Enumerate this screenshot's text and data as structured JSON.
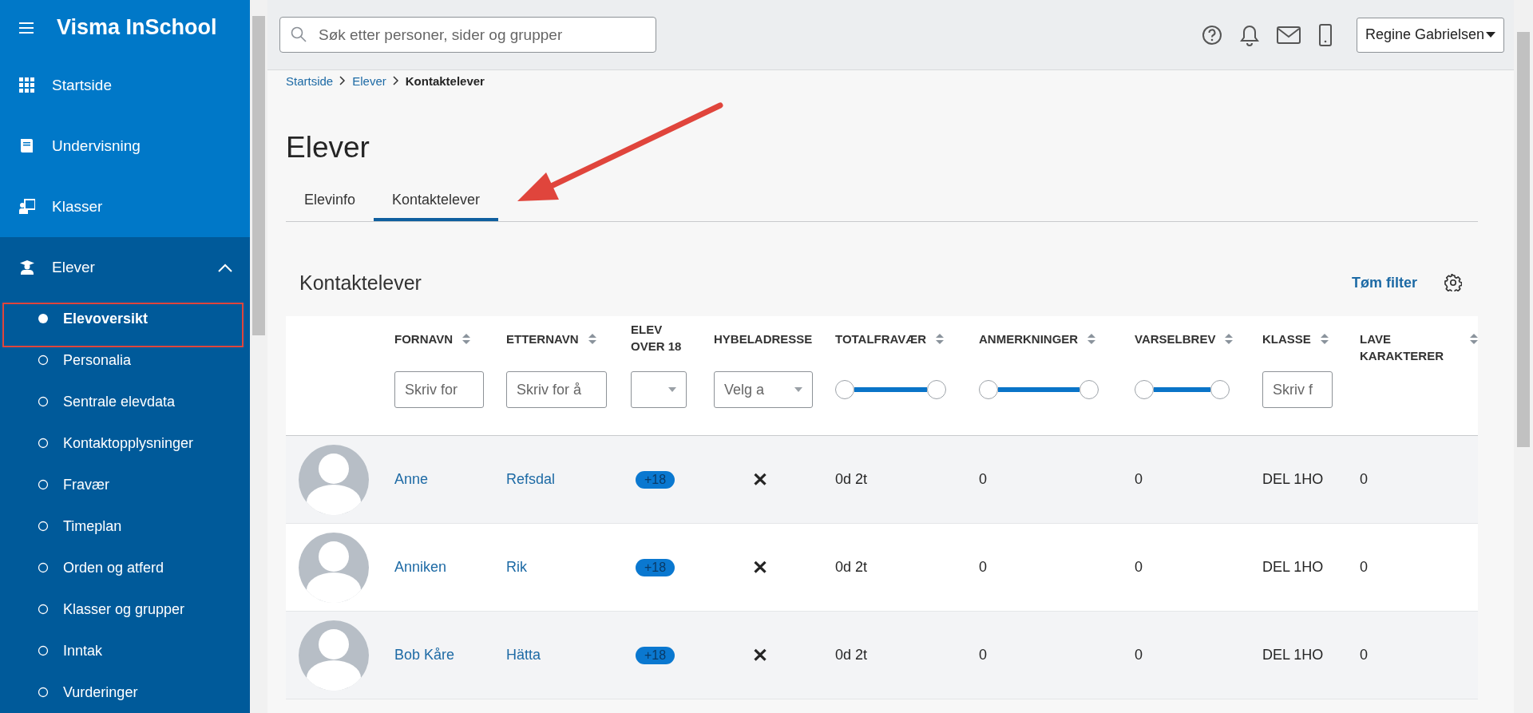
{
  "app": {
    "title": "Visma InSchool"
  },
  "sidebar": {
    "items": [
      {
        "label": "Startside",
        "kind": "grid",
        "expanded": false
      },
      {
        "label": "Undervisning",
        "kind": "book",
        "expanded": false
      },
      {
        "label": "Klasser",
        "kind": "board",
        "expanded": false
      },
      {
        "label": "Elever",
        "kind": "student",
        "expanded": true,
        "children": [
          {
            "label": "Elevoversikt",
            "selected": true
          },
          {
            "label": "Personalia",
            "selected": false
          },
          {
            "label": "Sentrale elevdata",
            "selected": false
          },
          {
            "label": "Kontaktopplysninger",
            "selected": false
          },
          {
            "label": "Fravær",
            "selected": false
          },
          {
            "label": "Timeplan",
            "selected": false
          },
          {
            "label": "Orden og atferd",
            "selected": false
          },
          {
            "label": "Klasser og grupper",
            "selected": false
          },
          {
            "label": "Inntak",
            "selected": false
          },
          {
            "label": "Vurderinger",
            "selected": false
          }
        ]
      }
    ]
  },
  "header": {
    "search": {
      "placeholder": "Søk etter personer, sider og grupper"
    },
    "user": "Regine Gabrielsen"
  },
  "breadcrumb": [
    {
      "label": "Startside",
      "current": false
    },
    {
      "label": "Elever",
      "current": false
    },
    {
      "label": "Kontaktelever",
      "current": true
    }
  ],
  "page_title": "Elever",
  "tabs": [
    {
      "label": "Elevinfo",
      "selected": false
    },
    {
      "label": "Kontaktelever",
      "selected": true
    }
  ],
  "panel": {
    "title": "Kontaktelever",
    "clear_filter": "Tøm filter"
  },
  "table": {
    "columns": [
      {
        "label": "FORNAVN",
        "sortable": true,
        "filter": {
          "kind": "text",
          "placeholder": "Skriv for"
        }
      },
      {
        "label": "ETTERNAVN",
        "sortable": true,
        "filter": {
          "kind": "text",
          "placeholder": "Skriv for å"
        }
      },
      {
        "label": "ELEV OVER 18",
        "sortable": false,
        "filter": {
          "kind": "select"
        }
      },
      {
        "label": "HYBELADRESSE",
        "sortable": false,
        "filter": {
          "kind": "select",
          "placeholder": "Velg a"
        }
      },
      {
        "label": "TOTALFRAVÆR",
        "sortable": true,
        "filter": {
          "kind": "range",
          "level": 1
        }
      },
      {
        "label": "ANMERKNINGER",
        "sortable": true,
        "filter": {
          "kind": "range",
          "level": 1
        }
      },
      {
        "label": "VARSELBREV",
        "sortable": true,
        "filter": {
          "kind": "range",
          "level": 1
        }
      },
      {
        "label": "KLASSE",
        "sortable": true,
        "filter": {
          "kind": "text",
          "placeholder": "Skriv f"
        }
      },
      {
        "label": "LAVE KARAKTERER",
        "sortable": true
      }
    ],
    "rows": [
      {
        "first_name": "Anne",
        "last_name": "Refsdal",
        "over_18": "+18",
        "hybel": "✕",
        "absence": "0d 2t",
        "remarks": "0",
        "warnings": "0",
        "class": "DEL 1HO",
        "low_grades": "0"
      },
      {
        "first_name": "Anniken",
        "last_name": "Rik",
        "over_18": "+18",
        "hybel": "✕",
        "absence": "0d 2t",
        "remarks": "0",
        "warnings": "0",
        "class": "DEL 1HO",
        "low_grades": "0"
      },
      {
        "first_name": "Bob Kåre",
        "last_name": "Hätta",
        "over_18": "+18",
        "hybel": "✕",
        "absence": "0d 2t",
        "remarks": "0",
        "warnings": "0",
        "class": "DEL 1HO",
        "low_grades": "0"
      }
    ]
  }
}
